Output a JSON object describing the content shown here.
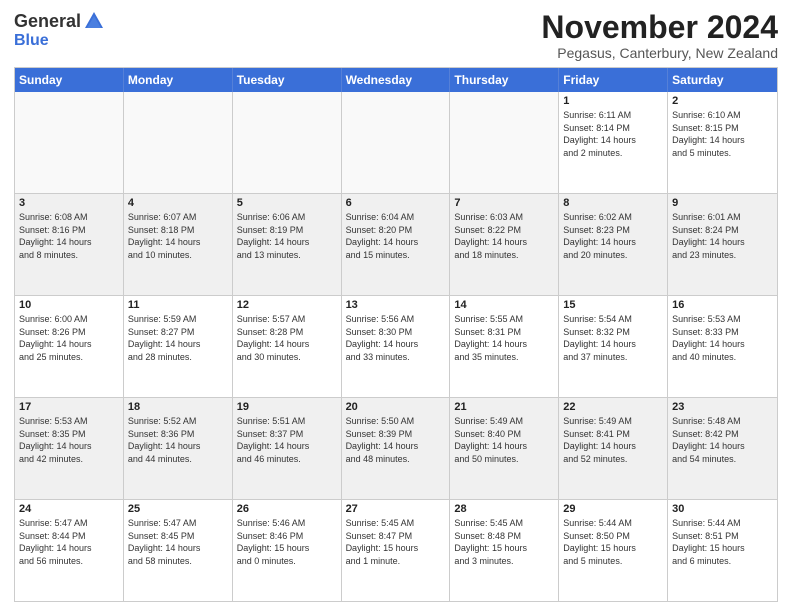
{
  "logo": {
    "general": "General",
    "blue": "Blue"
  },
  "title": "November 2024",
  "subtitle": "Pegasus, Canterbury, New Zealand",
  "header_days": [
    "Sunday",
    "Monday",
    "Tuesday",
    "Wednesday",
    "Thursday",
    "Friday",
    "Saturday"
  ],
  "rows": [
    [
      {
        "day": "",
        "empty": true
      },
      {
        "day": "",
        "empty": true
      },
      {
        "day": "",
        "empty": true
      },
      {
        "day": "",
        "empty": true
      },
      {
        "day": "",
        "empty": true
      },
      {
        "day": "1",
        "info": "Sunrise: 6:11 AM\nSunset: 8:14 PM\nDaylight: 14 hours\nand 2 minutes."
      },
      {
        "day": "2",
        "info": "Sunrise: 6:10 AM\nSunset: 8:15 PM\nDaylight: 14 hours\nand 5 minutes."
      }
    ],
    [
      {
        "day": "3",
        "info": "Sunrise: 6:08 AM\nSunset: 8:16 PM\nDaylight: 14 hours\nand 8 minutes."
      },
      {
        "day": "4",
        "info": "Sunrise: 6:07 AM\nSunset: 8:18 PM\nDaylight: 14 hours\nand 10 minutes."
      },
      {
        "day": "5",
        "info": "Sunrise: 6:06 AM\nSunset: 8:19 PM\nDaylight: 14 hours\nand 13 minutes."
      },
      {
        "day": "6",
        "info": "Sunrise: 6:04 AM\nSunset: 8:20 PM\nDaylight: 14 hours\nand 15 minutes."
      },
      {
        "day": "7",
        "info": "Sunrise: 6:03 AM\nSunset: 8:22 PM\nDaylight: 14 hours\nand 18 minutes."
      },
      {
        "day": "8",
        "info": "Sunrise: 6:02 AM\nSunset: 8:23 PM\nDaylight: 14 hours\nand 20 minutes."
      },
      {
        "day": "9",
        "info": "Sunrise: 6:01 AM\nSunset: 8:24 PM\nDaylight: 14 hours\nand 23 minutes."
      }
    ],
    [
      {
        "day": "10",
        "info": "Sunrise: 6:00 AM\nSunset: 8:26 PM\nDaylight: 14 hours\nand 25 minutes."
      },
      {
        "day": "11",
        "info": "Sunrise: 5:59 AM\nSunset: 8:27 PM\nDaylight: 14 hours\nand 28 minutes."
      },
      {
        "day": "12",
        "info": "Sunrise: 5:57 AM\nSunset: 8:28 PM\nDaylight: 14 hours\nand 30 minutes."
      },
      {
        "day": "13",
        "info": "Sunrise: 5:56 AM\nSunset: 8:30 PM\nDaylight: 14 hours\nand 33 minutes."
      },
      {
        "day": "14",
        "info": "Sunrise: 5:55 AM\nSunset: 8:31 PM\nDaylight: 14 hours\nand 35 minutes."
      },
      {
        "day": "15",
        "info": "Sunrise: 5:54 AM\nSunset: 8:32 PM\nDaylight: 14 hours\nand 37 minutes."
      },
      {
        "day": "16",
        "info": "Sunrise: 5:53 AM\nSunset: 8:33 PM\nDaylight: 14 hours\nand 40 minutes."
      }
    ],
    [
      {
        "day": "17",
        "info": "Sunrise: 5:53 AM\nSunset: 8:35 PM\nDaylight: 14 hours\nand 42 minutes."
      },
      {
        "day": "18",
        "info": "Sunrise: 5:52 AM\nSunset: 8:36 PM\nDaylight: 14 hours\nand 44 minutes."
      },
      {
        "day": "19",
        "info": "Sunrise: 5:51 AM\nSunset: 8:37 PM\nDaylight: 14 hours\nand 46 minutes."
      },
      {
        "day": "20",
        "info": "Sunrise: 5:50 AM\nSunset: 8:39 PM\nDaylight: 14 hours\nand 48 minutes."
      },
      {
        "day": "21",
        "info": "Sunrise: 5:49 AM\nSunset: 8:40 PM\nDaylight: 14 hours\nand 50 minutes."
      },
      {
        "day": "22",
        "info": "Sunrise: 5:49 AM\nSunset: 8:41 PM\nDaylight: 14 hours\nand 52 minutes."
      },
      {
        "day": "23",
        "info": "Sunrise: 5:48 AM\nSunset: 8:42 PM\nDaylight: 14 hours\nand 54 minutes."
      }
    ],
    [
      {
        "day": "24",
        "info": "Sunrise: 5:47 AM\nSunset: 8:44 PM\nDaylight: 14 hours\nand 56 minutes."
      },
      {
        "day": "25",
        "info": "Sunrise: 5:47 AM\nSunset: 8:45 PM\nDaylight: 14 hours\nand 58 minutes."
      },
      {
        "day": "26",
        "info": "Sunrise: 5:46 AM\nSunset: 8:46 PM\nDaylight: 15 hours\nand 0 minutes."
      },
      {
        "day": "27",
        "info": "Sunrise: 5:45 AM\nSunset: 8:47 PM\nDaylight: 15 hours\nand 1 minute."
      },
      {
        "day": "28",
        "info": "Sunrise: 5:45 AM\nSunset: 8:48 PM\nDaylight: 15 hours\nand 3 minutes."
      },
      {
        "day": "29",
        "info": "Sunrise: 5:44 AM\nSunset: 8:50 PM\nDaylight: 15 hours\nand 5 minutes."
      },
      {
        "day": "30",
        "info": "Sunrise: 5:44 AM\nSunset: 8:51 PM\nDaylight: 15 hours\nand 6 minutes."
      }
    ]
  ]
}
